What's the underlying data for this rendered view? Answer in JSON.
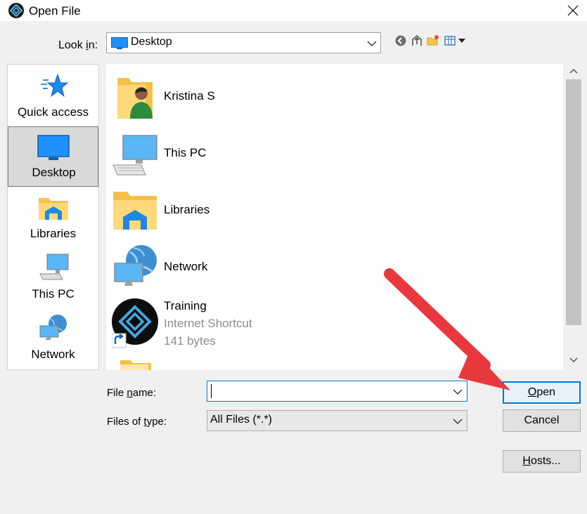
{
  "window": {
    "title": "Open File"
  },
  "look_in": {
    "label_pre": "Look ",
    "label_u": "i",
    "label_post": "n:",
    "value": "Desktop"
  },
  "places": [
    {
      "label": "Quick access",
      "icon": "star-icon"
    },
    {
      "label": "Desktop",
      "icon": "desktop-icon",
      "selected": true
    },
    {
      "label": "Libraries",
      "icon": "libraries-icon"
    },
    {
      "label": "This PC",
      "icon": "computer-icon"
    },
    {
      "label": "Network",
      "icon": "network-icon"
    }
  ],
  "files": [
    {
      "name": "Kristina S",
      "icon": "user-folder-icon"
    },
    {
      "name": "This PC",
      "icon": "computer-icon"
    },
    {
      "name": "Libraries",
      "icon": "libraries-icon"
    },
    {
      "name": "Network",
      "icon": "network-icon"
    },
    {
      "name": "Training",
      "type": "Internet Shortcut",
      "size": "141 bytes",
      "icon": "shortcut-icon"
    }
  ],
  "file_name": {
    "label_pre": "File ",
    "label_u": "n",
    "label_post": "ame:",
    "value": ""
  },
  "files_of_type": {
    "label_pre": "Files of ",
    "label_u": "t",
    "label_post": "ype:",
    "value": "All Files (*.*)"
  },
  "buttons": {
    "open_u": "O",
    "open_rest": "pen",
    "cancel": "Cancel",
    "hosts_u": "H",
    "hosts_rest": "osts..."
  },
  "colors": {
    "accent": "#0078d7",
    "arrow": "#e8383d"
  }
}
